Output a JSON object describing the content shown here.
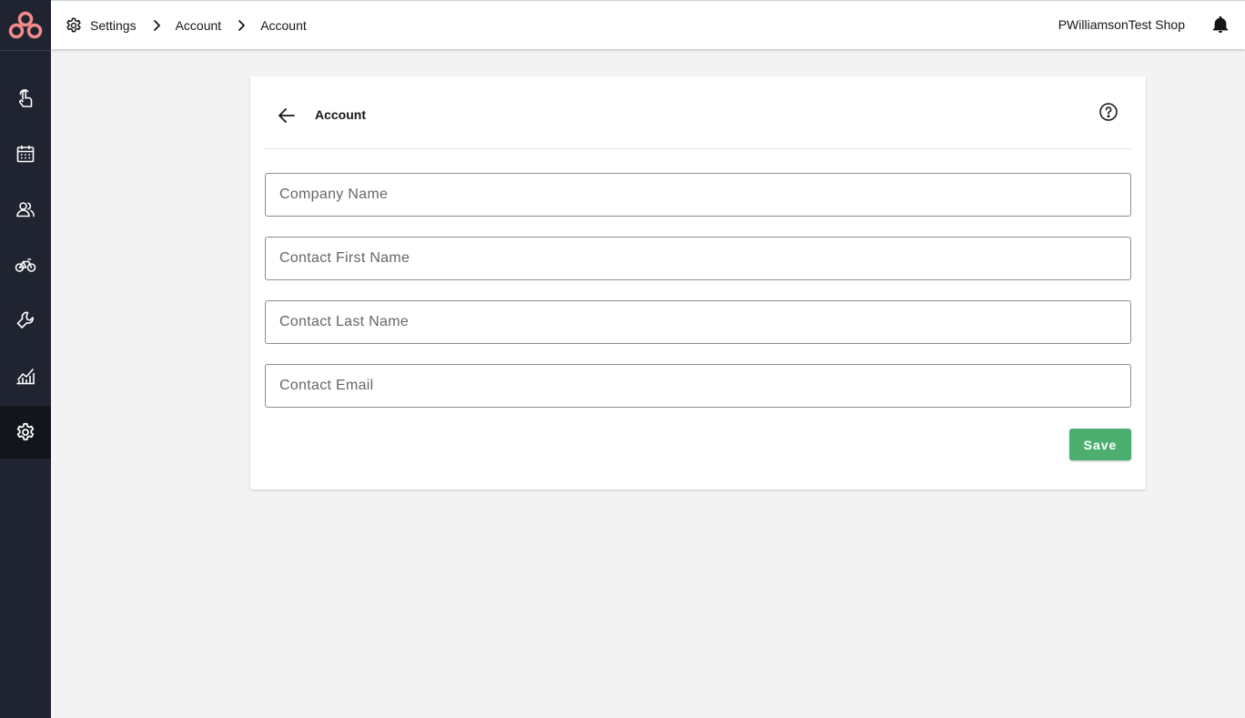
{
  "sidebar": {
    "logo": "brand-logo",
    "items": [
      {
        "icon": "touch-icon",
        "label": ""
      },
      {
        "icon": "calendar-icon",
        "label": ""
      },
      {
        "icon": "customers-icon",
        "label": ""
      },
      {
        "icon": "bicycle-icon",
        "label": ""
      },
      {
        "icon": "wrench-icon",
        "label": ""
      },
      {
        "icon": "analytics-icon",
        "label": ""
      },
      {
        "icon": "settings-icon",
        "label": "",
        "active": true
      }
    ]
  },
  "header": {
    "breadcrumb": [
      "Settings",
      "Account",
      "Account"
    ],
    "shop_name": "PWilliamsonTest Shop",
    "notification_icon": "bell-icon"
  },
  "card": {
    "title": "Account",
    "back_icon": "arrow-left-icon",
    "help_icon": "help-circle-icon"
  },
  "form": {
    "company_name": {
      "placeholder": "Company Name",
      "value": ""
    },
    "contact_first_name": {
      "placeholder": "Contact First Name",
      "value": ""
    },
    "contact_last_name": {
      "placeholder": "Contact Last Name",
      "value": ""
    },
    "contact_email": {
      "placeholder": "Contact Email",
      "value": ""
    },
    "save_label": "Save"
  },
  "colors": {
    "sidebar_bg": "#1f2430",
    "sidebar_active": "#12151c",
    "logo_accent": "#f28b8b",
    "save_button": "#4caf6e",
    "page_bg": "#f3f3f3"
  }
}
